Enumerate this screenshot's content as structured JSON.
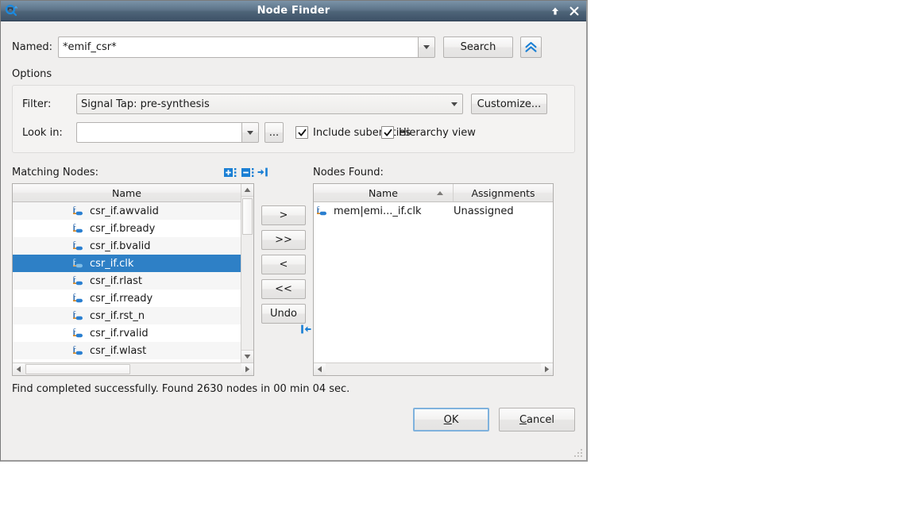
{
  "window": {
    "title": "Node Finder",
    "icon": "node-finder-icon",
    "buttons": [
      {
        "name": "shade-button",
        "icon": "arrow-up-icon"
      },
      {
        "name": "close-button",
        "icon": "close-x-icon"
      }
    ]
  },
  "search": {
    "named_label": "Named:",
    "named_value": "*emif_csr*",
    "search_button": "Search",
    "collapse_icon": "double-chevron-up-icon"
  },
  "options": {
    "group_label": "Options",
    "filter_label": "Filter:",
    "filter_value": "Signal Tap: pre-synthesis",
    "customize_button": "Customize...",
    "look_in_label": "Look in:",
    "look_in_value": "",
    "look_in_browse_button": "...",
    "include_subentities": {
      "label": "Include subentities",
      "checked": true
    },
    "hierarchy_view": {
      "label": "Hierarchy view",
      "checked": true
    }
  },
  "matching_nodes": {
    "title": "Matching Nodes:",
    "expand_icon": "expand-all-icon",
    "collapse_icon": "collapse-all-icon",
    "column_header": "Name",
    "rows": [
      {
        "name": "csr_if.awvalid",
        "selected": false
      },
      {
        "name": "csr_if.bready",
        "selected": false
      },
      {
        "name": "csr_if.bvalid",
        "selected": false
      },
      {
        "name": "csr_if.clk",
        "selected": true
      },
      {
        "name": "csr_if.rlast",
        "selected": false
      },
      {
        "name": "csr_if.rready",
        "selected": false
      },
      {
        "name": "csr_if.rst_n",
        "selected": false
      },
      {
        "name": "csr_if.rvalid",
        "selected": false
      },
      {
        "name": "csr_if.wlast",
        "selected": false
      }
    ]
  },
  "transfer": {
    "add_one": ">",
    "add_all": ">>",
    "remove_one": "<",
    "remove_all": "<<",
    "undo": "Undo",
    "top_icon": "panel-expand-right-icon",
    "bottom_icon": "panel-expand-left-icon"
  },
  "nodes_found": {
    "title": "Nodes Found:",
    "columns": [
      "Name",
      "Assignments"
    ],
    "sort_column": "Name",
    "sort_direction": "ascending",
    "rows": [
      {
        "name": "mem|emi..._if.clk",
        "assignment": "Unassigned"
      }
    ]
  },
  "status": {
    "message": "Find completed successfully. Found 2630 nodes in 00 min 04 sec."
  },
  "footer": {
    "ok_button": "OK",
    "ok_mnemonic": "O",
    "ok_rest": "K",
    "cancel_button": "Cancel",
    "cancel_mnemonic": "C",
    "cancel_rest": "ancel"
  },
  "colors": {
    "selection_blue": "#2e80c6",
    "accent_blue": "#1a7fd4",
    "titlebar_top": "#7b93a8",
    "titlebar_bottom": "#3d5167",
    "dialog_bg": "#f0efee"
  }
}
